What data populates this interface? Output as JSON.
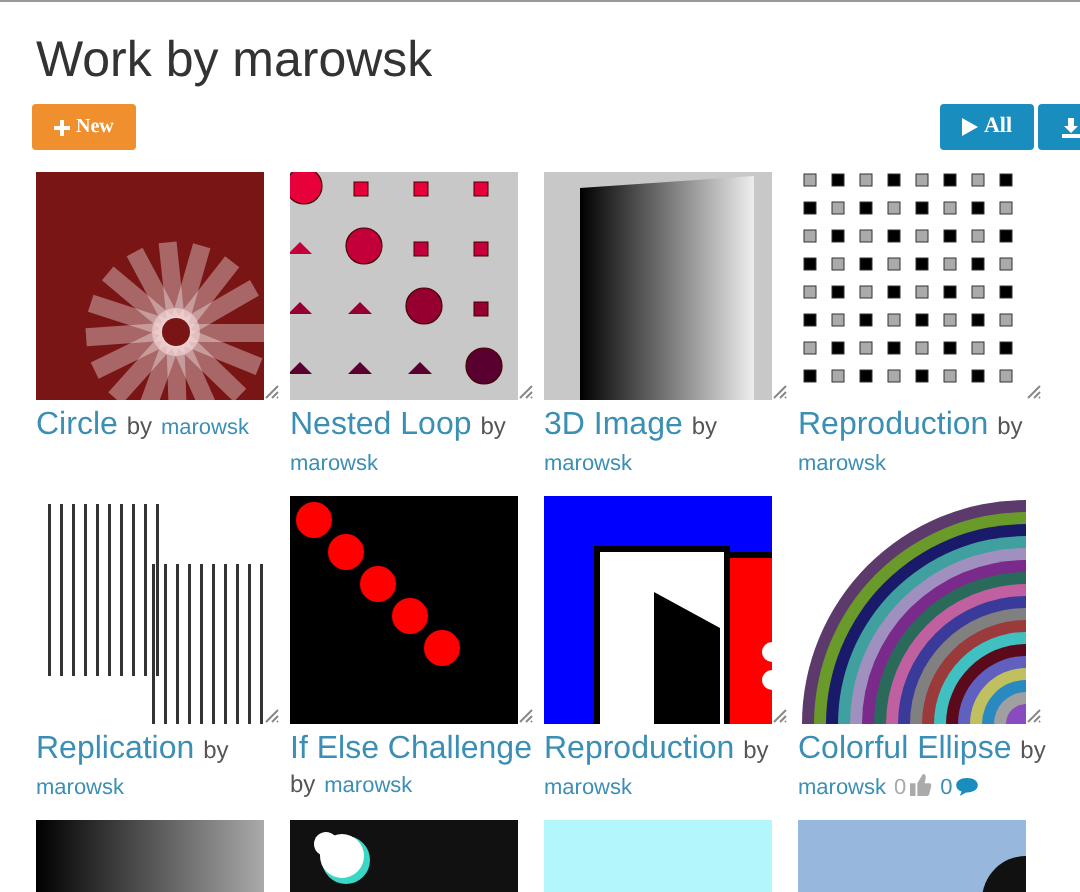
{
  "page": {
    "title": "Work by marowsk"
  },
  "toolbar": {
    "new_button": "New",
    "play_all_button": "All"
  },
  "cards": [
    {
      "kind": "project",
      "title": "Circle",
      "by": "by",
      "author": "marowsk"
    },
    {
      "kind": "project",
      "title": "Nested Loop",
      "by": "by",
      "author": "marowsk"
    },
    {
      "kind": "project",
      "title": "3D Image",
      "by": "by",
      "author": "marowsk"
    },
    {
      "kind": "project",
      "title": "Reproduction",
      "by": "by",
      "author": "marowsk"
    },
    {
      "kind": "project",
      "title": "Replication",
      "by": "by",
      "author": "marowsk"
    },
    {
      "kind": "project",
      "title": "If Else Challenge",
      "by": "by",
      "author": "marowsk"
    },
    {
      "kind": "project",
      "title": "Reproduction",
      "by": "by",
      "author": "marowsk"
    },
    {
      "kind": "project",
      "title": "Colorful Ellipse",
      "by": "by",
      "author": "marowsk",
      "likes": "0",
      "comments": "0"
    },
    {
      "kind": "thumbnail"
    },
    {
      "kind": "thumbnail"
    },
    {
      "kind": "thumbnail"
    },
    {
      "kind": "thumbnail"
    }
  ]
}
